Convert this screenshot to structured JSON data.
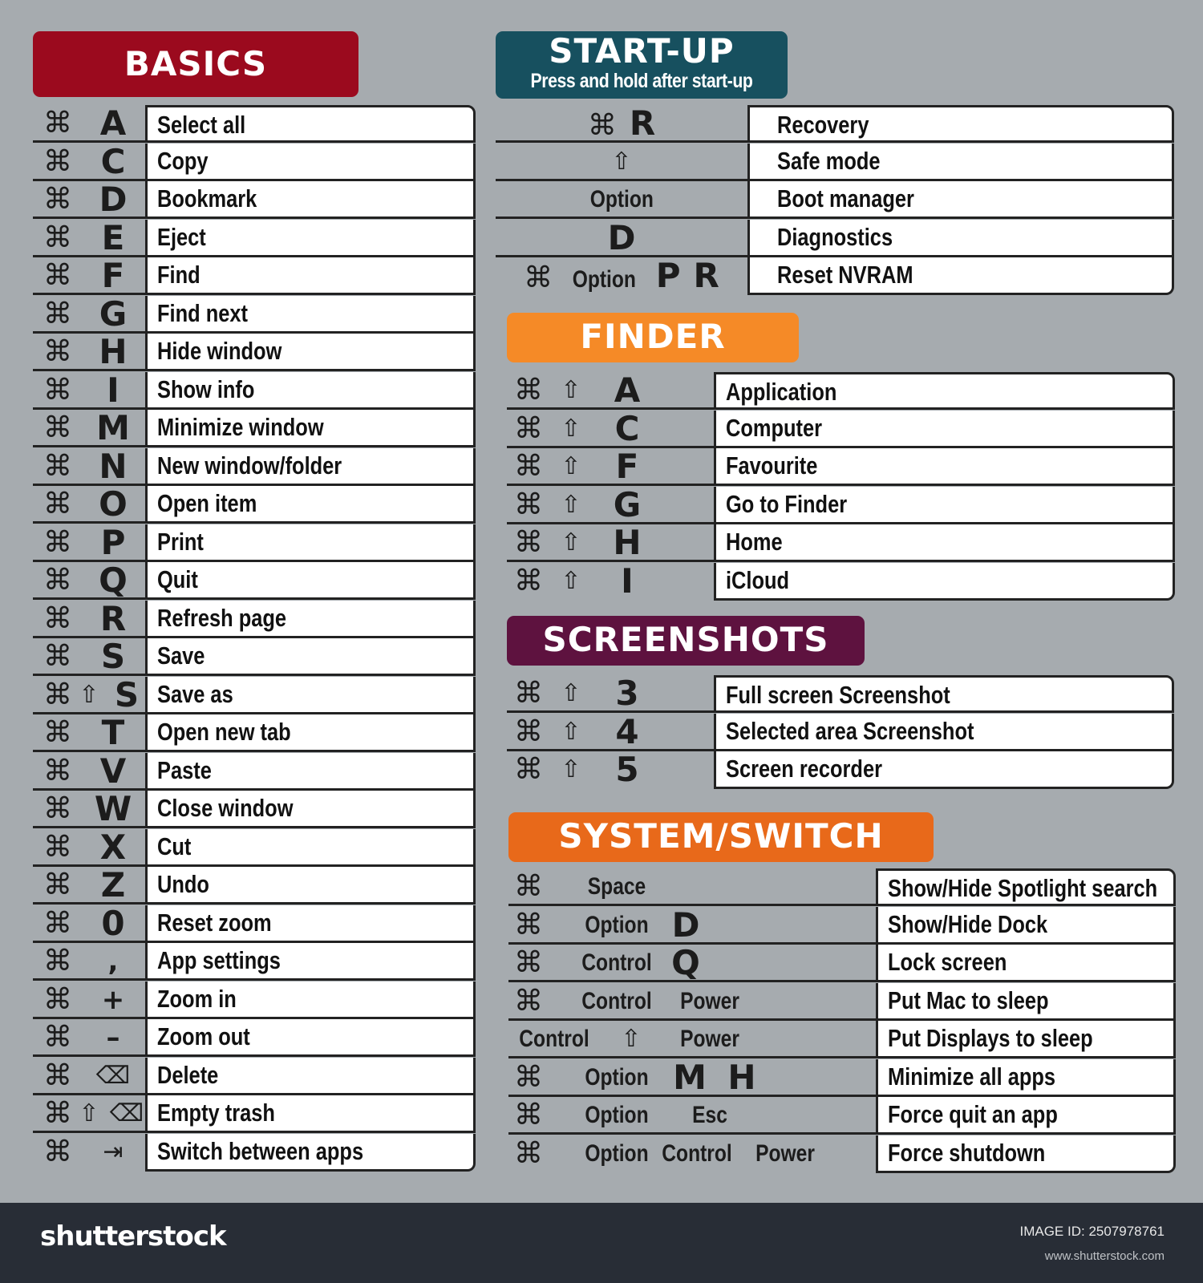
{
  "colors": {
    "background": "#a6abaf",
    "basics": "#9b0a1e",
    "startup": "#17505f",
    "finder": "#f58a27",
    "screenshots": "#5e123f",
    "system": "#e8691a",
    "footer": "#282d36"
  },
  "basics": {
    "title": "BASICS",
    "rows": [
      {
        "keys": [
          "⌘",
          "A"
        ],
        "action": "Select all"
      },
      {
        "keys": [
          "⌘",
          "C"
        ],
        "action": "Copy"
      },
      {
        "keys": [
          "⌘",
          "D"
        ],
        "action": "Bookmark"
      },
      {
        "keys": [
          "⌘",
          "E"
        ],
        "action": "Eject"
      },
      {
        "keys": [
          "⌘",
          "F"
        ],
        "action": "Find"
      },
      {
        "keys": [
          "⌘",
          "G"
        ],
        "action": "Find next"
      },
      {
        "keys": [
          "⌘",
          "H"
        ],
        "action": "Hide window"
      },
      {
        "keys": [
          "⌘",
          "I"
        ],
        "action": "Show info"
      },
      {
        "keys": [
          "⌘",
          "M"
        ],
        "action": "Minimize window"
      },
      {
        "keys": [
          "⌘",
          "N"
        ],
        "action": "New window/folder"
      },
      {
        "keys": [
          "⌘",
          "O"
        ],
        "action": "Open item"
      },
      {
        "keys": [
          "⌘",
          "P"
        ],
        "action": "Print"
      },
      {
        "keys": [
          "⌘",
          "Q"
        ],
        "action": "Quit"
      },
      {
        "keys": [
          "⌘",
          "R"
        ],
        "action": "Refresh page"
      },
      {
        "keys": [
          "⌘",
          "S"
        ],
        "action": "Save"
      },
      {
        "keys": [
          "⌘",
          "⇧",
          "S"
        ],
        "action": "Save as"
      },
      {
        "keys": [
          "⌘",
          "T"
        ],
        "action": "Open new tab"
      },
      {
        "keys": [
          "⌘",
          "V"
        ],
        "action": "Paste"
      },
      {
        "keys": [
          "⌘",
          "W"
        ],
        "action": "Close window"
      },
      {
        "keys": [
          "⌘",
          "X"
        ],
        "action": "Cut"
      },
      {
        "keys": [
          "⌘",
          "Z"
        ],
        "action": "Undo"
      },
      {
        "keys": [
          "⌘",
          "0"
        ],
        "action": "Reset zoom"
      },
      {
        "keys": [
          "⌘",
          ","
        ],
        "action": "App settings"
      },
      {
        "keys": [
          "⌘",
          "+"
        ],
        "action": "Zoom in"
      },
      {
        "keys": [
          "⌘",
          "–"
        ],
        "action": "Zoom out"
      },
      {
        "keys": [
          "⌘",
          "⌫"
        ],
        "action": "Delete"
      },
      {
        "keys": [
          "⌘",
          "⇧",
          "⌫"
        ],
        "action": "Empty trash"
      },
      {
        "keys": [
          "⌘",
          "⇥"
        ],
        "action": "Switch between apps"
      }
    ]
  },
  "startup": {
    "title": "START-UP",
    "subtitle": "Press and hold after start-up",
    "rows": [
      {
        "keys": [
          "⌘",
          "R"
        ],
        "action": "Recovery"
      },
      {
        "keys": [
          "⇧"
        ],
        "action": "Safe mode"
      },
      {
        "keys": [
          "Option"
        ],
        "action": "Boot manager"
      },
      {
        "keys": [
          "D"
        ],
        "action": "Diagnostics"
      },
      {
        "keys": [
          "⌘",
          "Option",
          "P",
          "R"
        ],
        "action": "Reset NVRAM"
      }
    ]
  },
  "finder": {
    "title": "FINDER",
    "rows": [
      {
        "keys": [
          "⌘",
          "⇧",
          "A"
        ],
        "action": "Application"
      },
      {
        "keys": [
          "⌘",
          "⇧",
          "C"
        ],
        "action": "Computer"
      },
      {
        "keys": [
          "⌘",
          "⇧",
          "F"
        ],
        "action": "Favourite"
      },
      {
        "keys": [
          "⌘",
          "⇧",
          "G"
        ],
        "action": "Go to Finder"
      },
      {
        "keys": [
          "⌘",
          "⇧",
          "H"
        ],
        "action": "Home"
      },
      {
        "keys": [
          "⌘",
          "⇧",
          "I"
        ],
        "action": "iCloud"
      }
    ]
  },
  "screenshots": {
    "title": "SCREENSHOTS",
    "rows": [
      {
        "keys": [
          "⌘",
          "⇧",
          "3"
        ],
        "action": "Full screen Screenshot"
      },
      {
        "keys": [
          "⌘",
          "⇧",
          "4"
        ],
        "action": "Selected area Screenshot"
      },
      {
        "keys": [
          "⌘",
          "⇧",
          "5"
        ],
        "action": "Screen recorder"
      }
    ]
  },
  "system": {
    "title": "SYSTEM/SWITCH",
    "rows": [
      {
        "keys": [
          "⌘",
          "Space"
        ],
        "action": "Show/Hide Spotlight search"
      },
      {
        "keys": [
          "⌘",
          "Option",
          "D"
        ],
        "action": "Show/Hide Dock"
      },
      {
        "keys": [
          "⌘",
          "Control",
          "Q"
        ],
        "action": "Lock screen"
      },
      {
        "keys": [
          "⌘",
          "Control",
          "Power"
        ],
        "action": "Put Mac to sleep"
      },
      {
        "keys": [
          "Control",
          "⇧",
          "Power"
        ],
        "action": "Put Displays to sleep"
      },
      {
        "keys": [
          "⌘",
          "Option",
          "M",
          "H"
        ],
        "action": "Minimize all apps"
      },
      {
        "keys": [
          "⌘",
          "Option",
          "Esc"
        ],
        "action": "Force quit an app"
      },
      {
        "keys": [
          "⌘",
          "Option",
          "Control",
          "Power"
        ],
        "action": "Force shutdown"
      }
    ]
  },
  "footer": {
    "brand": "shutterstock",
    "image_id": "IMAGE ID: 2507978761",
    "site": "www.shutterstock.com"
  }
}
